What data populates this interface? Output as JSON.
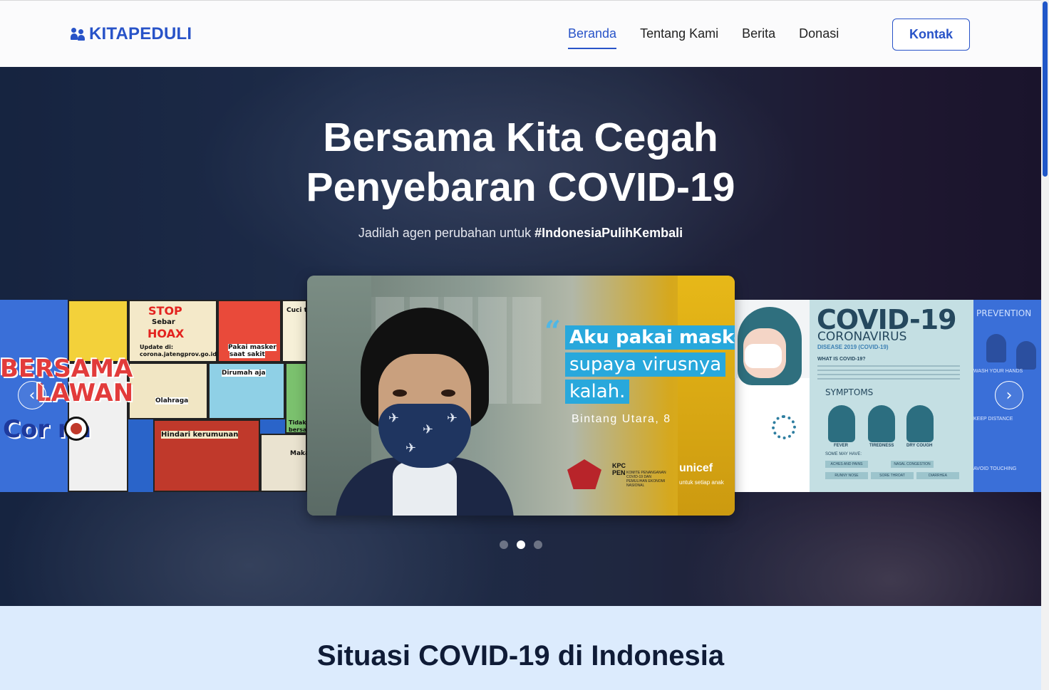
{
  "brand": {
    "name": "KITAPEDULI",
    "icon": "users-icon",
    "color": "#2853c8"
  },
  "nav": {
    "links": [
      {
        "label": "Beranda",
        "active": true
      },
      {
        "label": "Tentang Kami",
        "active": false
      },
      {
        "label": "Berita",
        "active": false
      },
      {
        "label": "Donasi",
        "active": false
      }
    ],
    "contact_button": "Kontak"
  },
  "hero": {
    "title_line1": "Bersama Kita Cegah",
    "title_line2": "Penyebaran COVID-19",
    "subtitle_prefix": "Jadilah agen perubahan untuk ",
    "subtitle_hashtag": "#IndonesiaPulihKembali"
  },
  "carousel": {
    "prev_icon": "chevron-left-icon",
    "next_icon": "chevron-right-icon",
    "active_index": 1,
    "dot_count": 3,
    "left_slide": {
      "bersama": "BERSAMA",
      "lawan": "LAWAN",
      "corona": "Cor  na",
      "stop": "STOP",
      "sebar": "Sebar",
      "hoax": "HOAX",
      "update_label": "Update di:",
      "update_url": "corona.jatengprov.go.id",
      "pakai_masker": "Pakai masker",
      "saat_sakit": "saat sakit",
      "cuci": "Cuci t",
      "olahraga": "Olahraga",
      "dirumah": "Dirumah aja",
      "tidak": "Tidak",
      "bersal": "bersal",
      "hindari": "Hindari kerumunan",
      "maka": "Maka"
    },
    "center_slide": {
      "quote_line1": "Aku pakai masker",
      "quote_line2": "supaya virusnya",
      "quote_line3": "kalah.",
      "author": "Bintang Utara, 8",
      "kpc_line1": "KPC",
      "kpc_line2": "PEN",
      "kpc_sub": "KOMITE PENANGANAN COVID-19 DAN PEMULIHAN EKONOMI NASIONAL",
      "unicef": "unicef",
      "unicef_sub": "untuk setiap anak"
    },
    "right_slide": {
      "title": "COVID-19",
      "subtitle": "CORONAVIRUS",
      "disease": "DISEASE 2019 (COVID-19)",
      "what_is": "WHAT IS COVID-19?",
      "symptoms": "SYMPTOMS",
      "symptom_items": [
        "FEVER",
        "TIREDNESS",
        "DRY COUGH"
      ],
      "some_may_have": "SOME MAY HAVE:",
      "chips": [
        "ACHES AND PAINS",
        "NASAL CONGESTION",
        "RUNNY NOSE",
        "SORE THROAT",
        "DIARRHEA"
      ],
      "prevention": "PREVENTION",
      "wash": "WASH YOUR HANDS",
      "keep": "KEEP DISTANCE",
      "avoid": "AVOID TOUCHING"
    }
  },
  "situasi": {
    "title": "Situasi COVID-19 di Indonesia"
  }
}
